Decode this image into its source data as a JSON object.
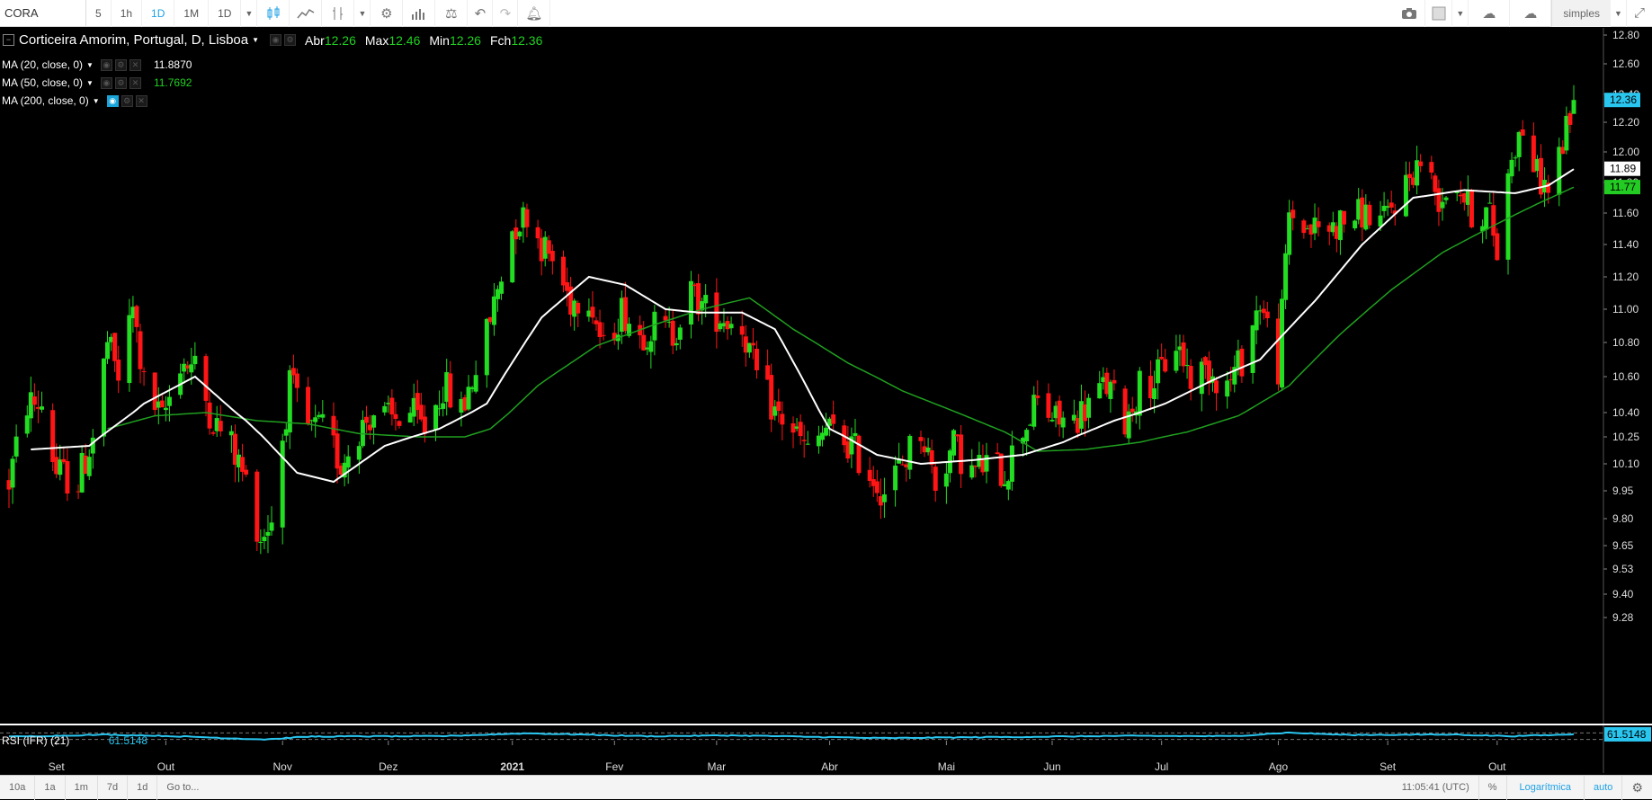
{
  "toolbar": {
    "symbol": "CORA",
    "intervals": [
      "5",
      "1h",
      "1D",
      "1M",
      "1D"
    ],
    "active_interval": 2,
    "chart_style": "simples"
  },
  "legend": {
    "title": "Corticeira Amorim, Portugal, D, Lisboa",
    "open_label": "Abr",
    "open_value": "12.26",
    "high_label": "Max",
    "high_value": "12.46",
    "low_label": "Min",
    "low_value": "12.26",
    "close_label": "Fch",
    "close_value": "12.36",
    "ma20_label": "MA (20, close, 0)",
    "ma20_value": "11.8870",
    "ma50_label": "MA (50, close, 0)",
    "ma50_value": "11.7692",
    "ma200_label": "MA (200, close, 0)"
  },
  "rsi": {
    "label": "RSI (IFR) (21)",
    "value": "61.5148",
    "badge": "61.5148"
  },
  "price_badges": {
    "last": "12.36",
    "ma20": "11.89",
    "ma50": "11.77"
  },
  "bottom_bar": {
    "ranges": [
      "10a",
      "1a",
      "1m",
      "7d",
      "1d"
    ],
    "goto": "Go to...",
    "time": "11:05:41 (UTC)",
    "percent": "%",
    "log": "Logarítmica",
    "auto": "auto"
  },
  "colors": {
    "up": "#22dd22",
    "down": "#ff1515",
    "ma20": "#ffffff",
    "ma50": "#20a020",
    "rsi": "#29c6f0",
    "accent": "#1da1e6"
  },
  "chart_data": {
    "type": "candlestick",
    "title": "Corticeira Amorim, Portugal, D, Lisboa",
    "y_ticks": [
      "12.80",
      "12.60",
      "12.40",
      "12.20",
      "12.00",
      "11.80",
      "11.60",
      "11.40",
      "11.20",
      "11.00",
      "10.80",
      "10.60",
      "10.40",
      "10.25",
      "10.10",
      "9.95",
      "9.80",
      "9.65",
      "9.53",
      "9.40",
      "9.28"
    ],
    "x_ticks": [
      "Set",
      "Out",
      "Nov",
      "Dez",
      "2021",
      "Fev",
      "Mar",
      "Abr",
      "Mai",
      "Jun",
      "Jul",
      "Ago",
      "Set",
      "Out"
    ],
    "x_tick_bold": [
      false,
      false,
      false,
      false,
      true,
      false,
      false,
      false,
      false,
      false,
      false,
      false,
      false,
      false
    ],
    "ylim": [
      9.28,
      12.8
    ],
    "close_anchors": [
      [
        "2020-08-19",
        10.0
      ],
      [
        "2020-08-24",
        10.45
      ],
      [
        "2020-08-28",
        10.45
      ],
      [
        "2020-09-01",
        10.05
      ],
      [
        "2020-09-07",
        10.0
      ],
      [
        "2020-09-11",
        10.25
      ],
      [
        "2020-09-15",
        10.8
      ],
      [
        "2020-09-18",
        10.6
      ],
      [
        "2020-09-22",
        11.0
      ],
      [
        "2020-09-25",
        10.55
      ],
      [
        "2020-09-30",
        10.35
      ],
      [
        "2020-10-05",
        10.7
      ],
      [
        "2020-10-09",
        10.65
      ],
      [
        "2020-10-14",
        10.35
      ],
      [
        "2020-10-19",
        10.2
      ],
      [
        "2020-10-23",
        10.0
      ],
      [
        "2020-10-27",
        9.7
      ],
      [
        "2020-10-30",
        9.8
      ],
      [
        "2020-11-04",
        10.55
      ],
      [
        "2020-11-09",
        10.3
      ],
      [
        "2020-11-13",
        10.3
      ],
      [
        "2020-11-18",
        10.1
      ],
      [
        "2020-11-23",
        10.3
      ],
      [
        "2020-11-27",
        10.4
      ],
      [
        "2020-12-02",
        10.35
      ],
      [
        "2020-12-07",
        10.4
      ],
      [
        "2020-12-11",
        10.3
      ],
      [
        "2020-12-16",
        10.55
      ],
      [
        "2020-12-21",
        10.4
      ],
      [
        "2020-12-28",
        10.85
      ],
      [
        "2021-01-04",
        11.5
      ],
      [
        "2021-01-08",
        11.6
      ],
      [
        "2021-01-12",
        11.4
      ],
      [
        "2021-01-15",
        11.3
      ],
      [
        "2021-01-20",
        11.05
      ],
      [
        "2021-01-25",
        11.1
      ],
      [
        "2021-01-29",
        10.75
      ],
      [
        "2021-02-03",
        11.0
      ],
      [
        "2021-02-08",
        10.85
      ],
      [
        "2021-02-12",
        10.9
      ],
      [
        "2021-02-17",
        10.85
      ],
      [
        "2021-02-22",
        11.1
      ],
      [
        "2021-02-26",
        11.0
      ],
      [
        "2021-03-03",
        10.95
      ],
      [
        "2021-03-08",
        10.9
      ],
      [
        "2021-03-12",
        10.6
      ],
      [
        "2021-03-17",
        10.4
      ],
      [
        "2021-03-22",
        10.3
      ],
      [
        "2021-03-26",
        10.15
      ],
      [
        "2021-03-31",
        10.3
      ],
      [
        "2021-04-07",
        10.2
      ],
      [
        "2021-04-12",
        10.05
      ],
      [
        "2021-04-16",
        9.95
      ],
      [
        "2021-04-21",
        10.1
      ],
      [
        "2021-04-26",
        10.3
      ],
      [
        "2021-04-30",
        10.0
      ],
      [
        "2021-05-05",
        10.2
      ],
      [
        "2021-05-10",
        10.05
      ],
      [
        "2021-05-14",
        10.1
      ],
      [
        "2021-05-19",
        10.05
      ],
      [
        "2021-05-24",
        10.3
      ],
      [
        "2021-05-28",
        10.45
      ],
      [
        "2021-06-02",
        10.35
      ],
      [
        "2021-06-07",
        10.35
      ],
      [
        "2021-06-11",
        10.45
      ],
      [
        "2021-06-16",
        10.55
      ],
      [
        "2021-06-21",
        10.35
      ],
      [
        "2021-06-25",
        10.55
      ],
      [
        "2021-06-30",
        10.6
      ],
      [
        "2021-07-05",
        10.8
      ],
      [
        "2021-07-09",
        10.6
      ],
      [
        "2021-07-14",
        10.65
      ],
      [
        "2021-07-19",
        10.55
      ],
      [
        "2021-07-23",
        10.7
      ],
      [
        "2021-07-28",
        11.05
      ],
      [
        "2021-08-02",
        10.65
      ],
      [
        "2021-08-05",
        11.6
      ],
      [
        "2021-08-10",
        11.5
      ],
      [
        "2021-08-16",
        11.5
      ],
      [
        "2021-08-20",
        11.55
      ],
      [
        "2021-08-25",
        11.6
      ],
      [
        "2021-08-31",
        11.55
      ],
      [
        "2021-09-06",
        11.8
      ],
      [
        "2021-09-10",
        11.95
      ],
      [
        "2021-09-15",
        11.7
      ],
      [
        "2021-09-20",
        11.8
      ],
      [
        "2021-09-24",
        11.6
      ],
      [
        "2021-09-29",
        11.6
      ],
      [
        "2021-10-01",
        11.35
      ],
      [
        "2021-10-05",
        12.0
      ],
      [
        "2021-10-08",
        12.15
      ],
      [
        "2021-10-12",
        11.85
      ],
      [
        "2021-10-15",
        11.75
      ],
      [
        "2021-10-19",
        12.05
      ],
      [
        "2021-10-22",
        12.36
      ]
    ],
    "ma20_anchors": [
      [
        "2020-08-25",
        10.18
      ],
      [
        "2020-09-10",
        10.2
      ],
      [
        "2020-09-25",
        10.45
      ],
      [
        "2020-10-09",
        10.6
      ],
      [
        "2020-10-23",
        10.35
      ],
      [
        "2020-11-06",
        10.05
      ],
      [
        "2020-11-16",
        10.0
      ],
      [
        "2020-11-30",
        10.2
      ],
      [
        "2020-12-15",
        10.3
      ],
      [
        "2020-12-28",
        10.45
      ],
      [
        "2021-01-12",
        10.95
      ],
      [
        "2021-01-25",
        11.2
      ],
      [
        "2021-02-04",
        11.15
      ],
      [
        "2021-02-15",
        11.0
      ],
      [
        "2021-02-24",
        10.98
      ],
      [
        "2021-03-08",
        10.98
      ],
      [
        "2021-03-17",
        10.88
      ],
      [
        "2021-04-01",
        10.3
      ],
      [
        "2021-04-14",
        10.15
      ],
      [
        "2021-04-26",
        10.1
      ],
      [
        "2021-05-10",
        10.12
      ],
      [
        "2021-05-24",
        10.15
      ],
      [
        "2021-06-04",
        10.22
      ],
      [
        "2021-06-18",
        10.35
      ],
      [
        "2021-07-02",
        10.45
      ],
      [
        "2021-07-15",
        10.58
      ],
      [
        "2021-07-28",
        10.7
      ],
      [
        "2021-08-12",
        11.05
      ],
      [
        "2021-08-25",
        11.4
      ],
      [
        "2021-09-08",
        11.7
      ],
      [
        "2021-09-22",
        11.75
      ],
      [
        "2021-10-06",
        11.73
      ],
      [
        "2021-10-15",
        11.78
      ],
      [
        "2021-10-22",
        11.887
      ]
    ],
    "ma50_anchors": [
      [
        "2020-09-15",
        10.3
      ],
      [
        "2020-09-28",
        10.38
      ],
      [
        "2020-10-12",
        10.4
      ],
      [
        "2020-10-26",
        10.35
      ],
      [
        "2020-11-09",
        10.33
      ],
      [
        "2020-11-23",
        10.27
      ],
      [
        "2020-12-09",
        10.25
      ],
      [
        "2020-12-22",
        10.25
      ],
      [
        "2020-12-29",
        10.3
      ],
      [
        "2021-01-11",
        10.55
      ],
      [
        "2021-01-27",
        10.78
      ],
      [
        "2021-02-11",
        10.9
      ],
      [
        "2021-02-25",
        11.0
      ],
      [
        "2021-03-10",
        11.07
      ],
      [
        "2021-03-22",
        10.88
      ],
      [
        "2021-04-06",
        10.68
      ],
      [
        "2021-04-21",
        10.52
      ],
      [
        "2021-05-06",
        10.4
      ],
      [
        "2021-05-19",
        10.28
      ],
      [
        "2021-05-28",
        10.17
      ],
      [
        "2021-06-10",
        10.18
      ],
      [
        "2021-06-25",
        10.22
      ],
      [
        "2021-07-08",
        10.28
      ],
      [
        "2021-07-22",
        10.38
      ],
      [
        "2021-08-05",
        10.55
      ],
      [
        "2021-08-19",
        10.85
      ],
      [
        "2021-09-02",
        11.12
      ],
      [
        "2021-09-16",
        11.35
      ],
      [
        "2021-09-30",
        11.52
      ],
      [
        "2021-10-12",
        11.66
      ],
      [
        "2021-10-22",
        11.769
      ]
    ],
    "rsi_anchors": [
      [
        "2020-08-19",
        47
      ],
      [
        "2020-09-15",
        60
      ],
      [
        "2020-10-01",
        52
      ],
      [
        "2020-10-28",
        30
      ],
      [
        "2020-11-10",
        48
      ],
      [
        "2020-12-15",
        50
      ],
      [
        "2021-01-08",
        68
      ],
      [
        "2021-02-10",
        50
      ],
      [
        "2021-03-05",
        55
      ],
      [
        "2021-04-15",
        38
      ],
      [
        "2021-05-20",
        45
      ],
      [
        "2021-06-20",
        52
      ],
      [
        "2021-07-20",
        50
      ],
      [
        "2021-08-05",
        72
      ],
      [
        "2021-08-20",
        58
      ],
      [
        "2021-09-20",
        60
      ],
      [
        "2021-10-05",
        50
      ],
      [
        "2021-10-22",
        61.5
      ]
    ],
    "last": {
      "open": 12.26,
      "high": 12.46,
      "low": 12.26,
      "close": 12.36
    }
  }
}
